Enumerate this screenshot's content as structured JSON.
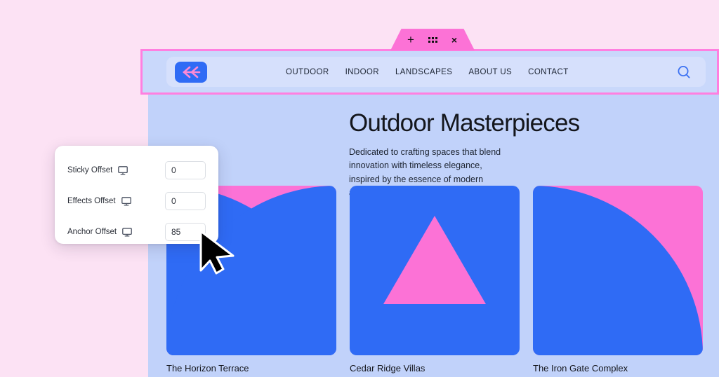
{
  "colors": {
    "canvas_bg": "#fce2f4",
    "page_bg": "#c1d2fa",
    "nav_pill_bg": "#d6e0fc",
    "selection_border": "#ff7fe0",
    "toolbar_tab_bg": "#fc72d6",
    "brand_blue": "#2f6bf5",
    "brand_pink": "#fc72d6",
    "text_dark": "#14161c"
  },
  "toolbar": {
    "add_label": "+",
    "drag_handle_icon": "six-dot-drag-handle-icon",
    "close_label": "×"
  },
  "nav": {
    "logo_icon": "double-chevron-left-logo",
    "links": [
      {
        "label": "OUTDOOR"
      },
      {
        "label": "INDOOR"
      },
      {
        "label": "LANDSCAPES"
      },
      {
        "label": "ABOUT US"
      },
      {
        "label": "CONTACT"
      }
    ],
    "search_icon": "search-icon"
  },
  "hero": {
    "title": "Outdoor Masterpieces",
    "subtitle": "Dedicated to crafting spaces that blend innovation with timeless elegance, inspired by the essence of modern architecture."
  },
  "gallery": {
    "cards": [
      {
        "title": "The Horizon Terrace",
        "artwork": "quarter-circle-bottom-left",
        "bg": "#fc72d6",
        "fg": "#2f6bf5"
      },
      {
        "title": "Cedar Ridge Villas",
        "artwork": "triangle-centered",
        "bg": "#2f6bf5",
        "fg": "#fc72d6"
      },
      {
        "title": "The Iron Gate Complex",
        "artwork": "quarter-circle-top-left",
        "bg": "#fc72d6",
        "fg": "#2f6bf5"
      }
    ]
  },
  "settings_panel": {
    "rows": [
      {
        "label": "Sticky Offset",
        "device_icon": "desktop-monitor-icon",
        "value": "0"
      },
      {
        "label": "Effects Offset",
        "device_icon": "desktop-monitor-icon",
        "value": "0"
      },
      {
        "label": "Anchor Offset",
        "device_icon": "desktop-monitor-icon",
        "value": "85"
      }
    ]
  },
  "cursor": {
    "icon": "mouse-arrow-cursor"
  }
}
